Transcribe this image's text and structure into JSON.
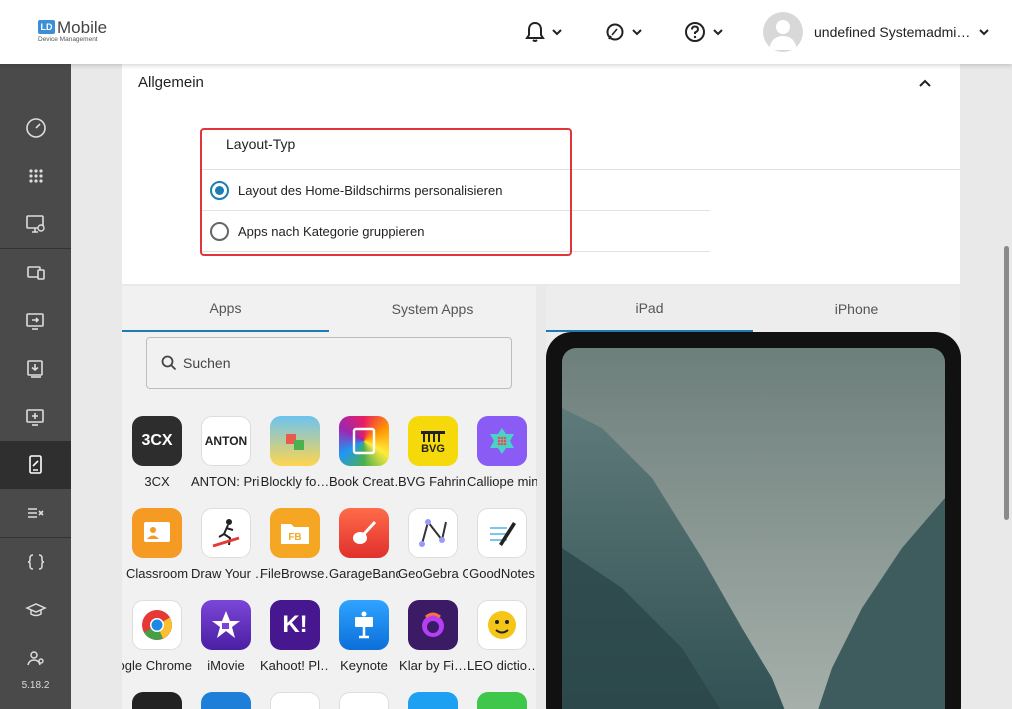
{
  "header": {
    "logo_mark": "LD",
    "logo_title": "Mobile",
    "logo_sub": "Device Management",
    "user_name": "undefined Systemadmi…"
  },
  "sidebar": {
    "version": "5.18.2",
    "items": [
      {
        "icon": "dashboard-icon"
      },
      {
        "icon": "apps-grid-icon"
      },
      {
        "icon": "monitor-settings-icon"
      },
      {
        "icon": "devices-icon"
      },
      {
        "icon": "screen-share-icon"
      },
      {
        "icon": "download-device-icon"
      },
      {
        "icon": "add-device-icon"
      },
      {
        "icon": "device-edit-icon",
        "active": true
      },
      {
        "icon": "list-check-icon"
      },
      {
        "icon": "braces-icon"
      },
      {
        "icon": "graduation-cap-icon"
      },
      {
        "icon": "users-icon"
      }
    ]
  },
  "section": {
    "title": "Allgemein",
    "layout_label": "Layout-Typ",
    "options": [
      {
        "label": "Layout des Home-Bildschirms personalisieren",
        "checked": true
      },
      {
        "label": "Apps nach Kategorie gruppieren",
        "checked": false
      }
    ]
  },
  "apps_panel": {
    "tabs": [
      "Apps",
      "System Apps"
    ],
    "active_tab": "Apps",
    "search_placeholder": "Suchen",
    "apps": [
      {
        "name": "3CX",
        "icon_text": "3CX"
      },
      {
        "name": "ANTON: Pri…",
        "icon_text": "ANTON"
      },
      {
        "name": "Blockly fo…",
        "icon_text": ""
      },
      {
        "name": "Book Creat…",
        "icon_text": ""
      },
      {
        "name": "BVG Fahrin…",
        "icon_text": "BVG"
      },
      {
        "name": "Calliope min",
        "icon_text": ""
      },
      {
        "name": "Classroom",
        "icon_text": ""
      },
      {
        "name": "Draw Your …",
        "icon_text": ""
      },
      {
        "name": "FileBrowse…",
        "icon_text": "FB"
      },
      {
        "name": "GarageBand",
        "icon_text": ""
      },
      {
        "name": "GeoGebra G…",
        "icon_text": ""
      },
      {
        "name": "GoodNotes",
        "icon_text": ""
      },
      {
        "name": "Google Chrome",
        "icon_text": ""
      },
      {
        "name": "iMovie",
        "icon_text": ""
      },
      {
        "name": "Kahoot! Pl…",
        "icon_text": "K!"
      },
      {
        "name": "Keynote",
        "icon_text": ""
      },
      {
        "name": "Klar by Fi…",
        "icon_text": ""
      },
      {
        "name": "LEO dictio…",
        "icon_text": ""
      }
    ]
  },
  "device_panel": {
    "tabs": [
      "iPad",
      "iPhone"
    ],
    "active_tab": "iPad"
  },
  "colors": {
    "accent": "#1d7cb3",
    "highlight_border": "#e0353b",
    "sidebar": "#4a4a4a"
  }
}
